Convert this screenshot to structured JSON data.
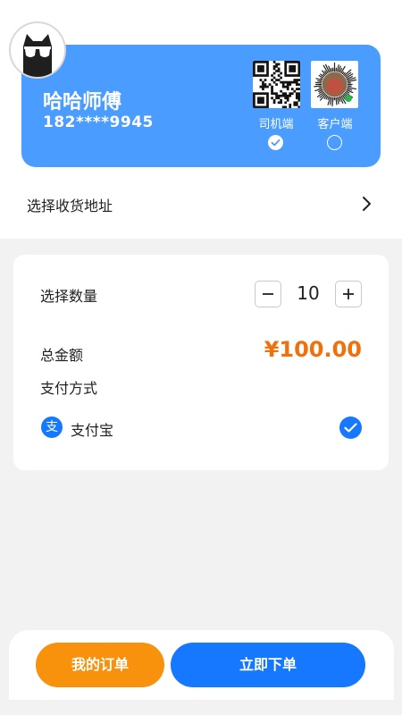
{
  "profile": {
    "avatar_icon": "cat-with-sunglasses-icon",
    "name": "哈哈师傅",
    "phone": "182****9945"
  },
  "qr_codes": [
    {
      "label": "司机端",
      "selected": true
    },
    {
      "label": "客户端",
      "selected": false
    }
  ],
  "address": {
    "label": "选择收货地址",
    "arrow_icon": "chevron-right-icon"
  },
  "order": {
    "quantity_label": "选择数量",
    "minus_symbol": "−",
    "quantity": "10",
    "plus_symbol": "+",
    "total_label": "总金额",
    "total_value": "¥100.00",
    "payment_label": "支付方式",
    "payment_icon_glyph": "支",
    "payment_method": "支付宝",
    "payment_selected": true
  },
  "actions": {
    "my_orders": "我的订单",
    "order_now": "立即下单"
  },
  "colors": {
    "card_blue": "#4a9cff",
    "primary_blue": "#1677ff",
    "orange": "#f8920c",
    "price_orange": "#f0700c",
    "background": "#f2f2f2"
  }
}
